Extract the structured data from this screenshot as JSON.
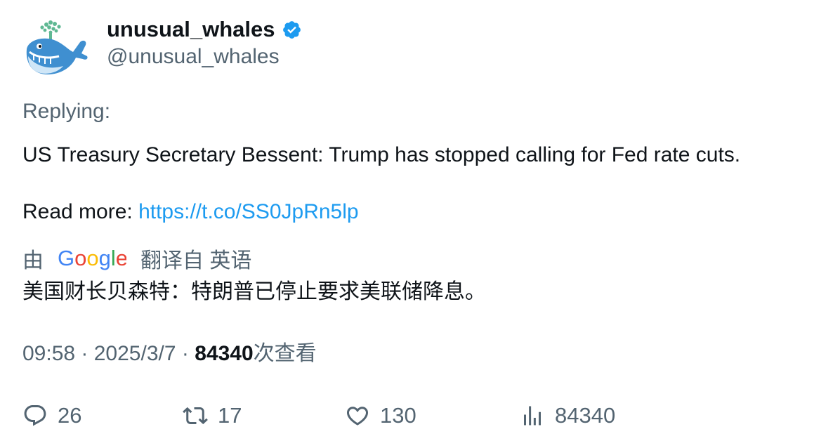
{
  "user": {
    "display_name": "unusual_whales",
    "handle": "@unusual_whales",
    "verified": true,
    "verified_color": "#1d9bf0"
  },
  "tweet": {
    "replying_label": "Replying:",
    "text": "US Treasury Secretary Bessent: Trump has stopped calling for Fed rate cuts.",
    "read_more_label": "Read more: ",
    "link": "https://t.co/SS0JpRn5lp",
    "link_color": "#1d9bf0"
  },
  "translation": {
    "prefix": "由",
    "provider": "Google",
    "suffix": "翻译自 英语",
    "text": "美国财长贝森特：特朗普已停止要求美联储降息。"
  },
  "meta": {
    "time": "09:58",
    "separator": " · ",
    "date": "2025/3/7",
    "views": "84340",
    "views_suffix": "次查看"
  },
  "actions": {
    "replies": "26",
    "retweets": "17",
    "likes": "130",
    "views": "84340"
  },
  "icons": {
    "reply": "reply-bubble-icon",
    "retweet": "retweet-icon",
    "like": "heart-icon",
    "views": "bar-chart-icon"
  }
}
